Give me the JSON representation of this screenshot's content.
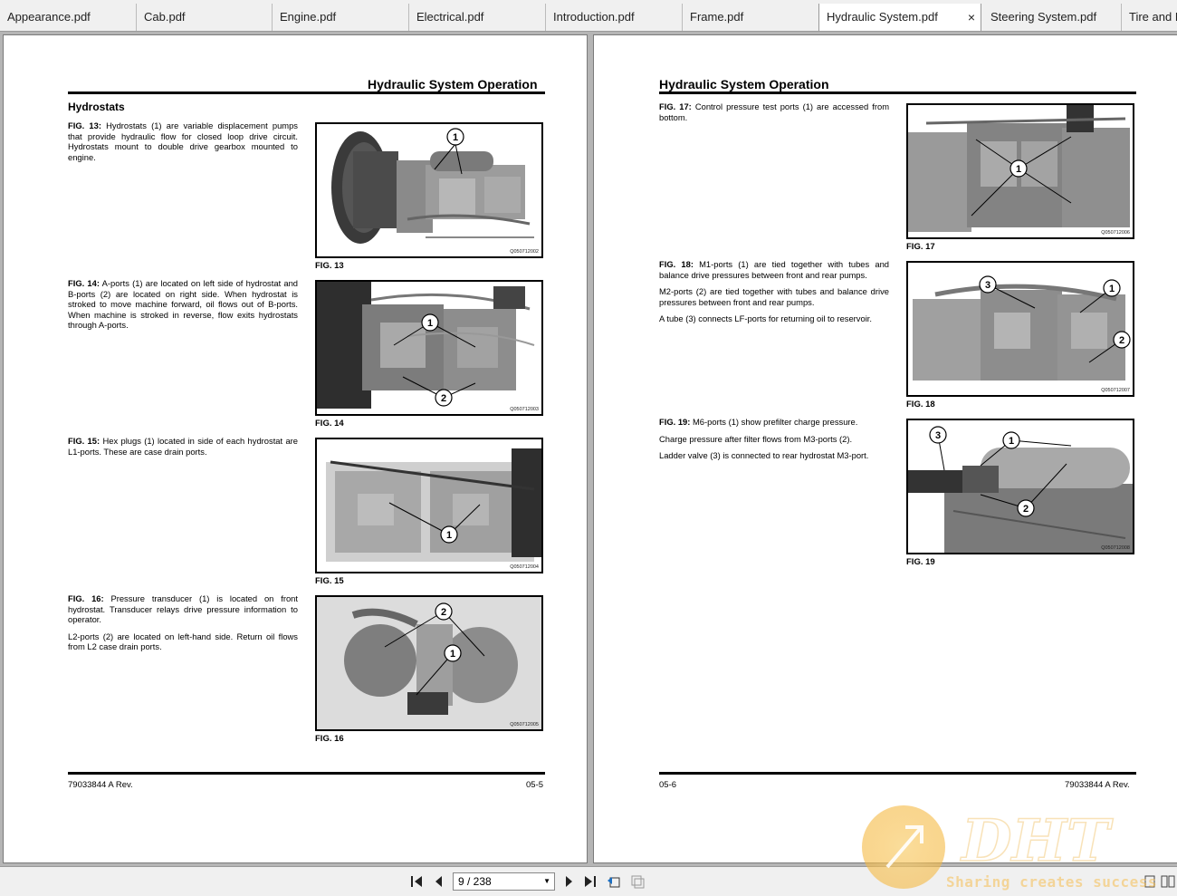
{
  "tabs": [
    {
      "label": "Appearance.pdf"
    },
    {
      "label": "Cab.pdf"
    },
    {
      "label": "Engine.pdf"
    },
    {
      "label": "Electrical.pdf"
    },
    {
      "label": "Introduction.pdf"
    },
    {
      "label": "Frame.pdf"
    },
    {
      "label": "Hydraulic System.pdf"
    },
    {
      "label": "Steering System.pdf"
    },
    {
      "label": "Tire and R"
    }
  ],
  "active_tab_close": "×",
  "left_page": {
    "header": "Hydraulic System Operation",
    "section": "Hydrostats",
    "blocks": [
      {
        "fig_label": "FIG. 13:",
        "paragraphs": [
          "Hydrostats (1) are variable displacement pumps that provide hydraulic flow for closed loop drive circuit. Hydrostats mount to double drive gearbox mounted to engine."
        ],
        "caption": "FIG. 13",
        "code": "Q050712002",
        "callouts": [
          "1"
        ]
      },
      {
        "fig_label": "FIG. 14:",
        "paragraphs": [
          "A-ports (1) are located on left side of hydrostat and B-ports (2) are located on right side. When hydrostat is stroked to move machine forward, oil flows out of B-ports. When machine is stroked in reverse, flow exits hydrostats through A-ports."
        ],
        "caption": "FIG. 14",
        "code": "Q050712003",
        "callouts": [
          "1",
          "2"
        ]
      },
      {
        "fig_label": "FIG. 15:",
        "paragraphs": [
          "Hex plugs (1) located in side of each hydrostat are L1-ports. These are case drain ports."
        ],
        "caption": "FIG. 15",
        "code": "Q050712004",
        "callouts": [
          "1"
        ]
      },
      {
        "fig_label": "FIG. 16:",
        "paragraphs": [
          "Pressure transducer (1) is located on front hydrostat. Transducer relays drive pressure information to operator.",
          "L2-ports (2) are located on left-hand side. Return oil flows from L2 case drain ports."
        ],
        "caption": "FIG. 16",
        "code": "Q050712005",
        "callouts": [
          "2",
          "1"
        ]
      }
    ],
    "footer_left": "79033844 A Rev.",
    "footer_right": "05-5"
  },
  "right_page": {
    "header": "Hydraulic System Operation",
    "blocks": [
      {
        "fig_label": "FIG. 17:",
        "paragraphs": [
          "Control pressure test ports (1) are accessed from bottom."
        ],
        "caption": "FIG. 17",
        "code": "Q050712006",
        "callouts": [
          "1"
        ]
      },
      {
        "fig_label": "FIG. 18:",
        "paragraphs": [
          "M1-ports (1) are tied together with tubes and balance drive pressures between front and rear pumps.",
          "M2-ports (2) are tied together with tubes and balance drive pressures between front and rear pumps.",
          "A tube (3) connects LF-ports for returning oil to reservoir."
        ],
        "caption": "FIG. 18",
        "code": "Q050712007",
        "callouts": [
          "3",
          "1",
          "2"
        ]
      },
      {
        "fig_label": "FIG. 19:",
        "paragraphs": [
          "M6-ports (1) show prefilter charge pressure.",
          "Charge pressure after filter flows from M3-ports (2).",
          "Ladder valve (3) is connected to rear hydrostat M3-port."
        ],
        "caption": "FIG. 19",
        "code": "Q050712008",
        "callouts": [
          "3",
          "1",
          "2"
        ]
      }
    ],
    "footer_left": "05-6",
    "footer_right": "79033844 A Rev."
  },
  "nav": {
    "page_indicator": "9 / 238"
  },
  "watermark": {
    "logo_text": "DHT",
    "tagline": "Sharing creates success"
  },
  "colors": {
    "watermark_orange": "#f5b942",
    "tab_bar": "#f0f0f0",
    "viewer_bg": "#b5b5b5"
  }
}
